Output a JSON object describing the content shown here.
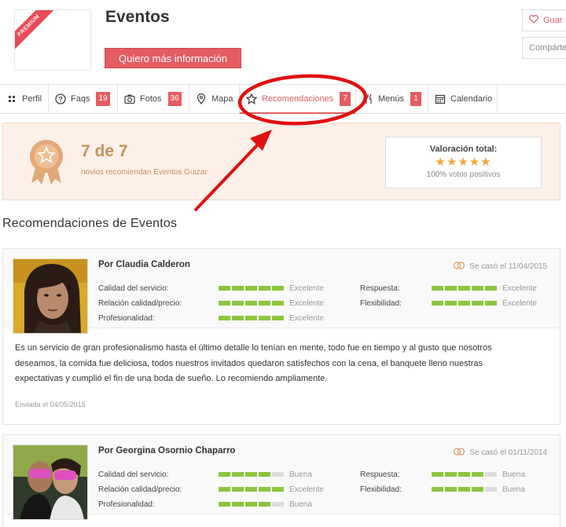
{
  "header": {
    "title": "Eventos",
    "premium_label": "PREMIUM",
    "info_button": "Quiero más información",
    "save_label": "Guar",
    "share_label": "Compártel"
  },
  "tabs": [
    {
      "label": "Perfil",
      "icon": "grid-icon"
    },
    {
      "label": "Faqs",
      "icon": "question-icon",
      "badge": "19"
    },
    {
      "label": "Fotos",
      "icon": "camera-icon",
      "badge": "36"
    },
    {
      "label": "Mapa",
      "icon": "map-pin-icon"
    },
    {
      "label": "Recomendaciones",
      "icon": "star-icon",
      "badge": "7",
      "active": true
    },
    {
      "label": "Menús",
      "icon": "cutlery-icon",
      "badge": "1"
    },
    {
      "label": "Calendario",
      "icon": "calendar-icon"
    }
  ],
  "summary": {
    "count": "7 de 7",
    "subtitle": "novios recomiendan Eventos Guizar",
    "rating_title": "Valoración total:",
    "rating_stars": 5,
    "rating_sub": "100% votos positivos"
  },
  "section_title": "Recomendaciones de Eventos",
  "colors": {
    "accent": "#e45d63",
    "gold": "#c8915f",
    "bar_on": "#8cc63f",
    "bar_off": "#dddddd",
    "star": "#f0a53b"
  },
  "reviews": [
    {
      "author": "Por Claudia Calderon",
      "wedding_date": "Se casó el 11/04/2015",
      "criteria_left": [
        {
          "label": "Calidad del servicio:",
          "score": 5,
          "value": "Excelente"
        },
        {
          "label": "Relación calidad/precio:",
          "score": 5,
          "value": "Excelente"
        },
        {
          "label": "Profesionalidad:",
          "score": 5,
          "value": "Excelente"
        }
      ],
      "criteria_right": [
        {
          "label": "Respuesta:",
          "score": 5,
          "value": "Excelente"
        },
        {
          "label": "Flexibilidad:",
          "score": 5,
          "value": "Excelente"
        }
      ],
      "lines": [
        "Es un servicio de gran profesionalismo hasta el último detalle lo tenían en mente, todo fue en tiempo y al gusto que nosotros",
        "deseamos, la comida fue deliciosa, todos nuestros invitados quedaron satisfechos con la cena, el banquete lleno nuestras",
        "expectativas y cumplió el fin de una boda de sueño. Lo recomiendo ampliamente."
      ],
      "sent": "Enviada el 04/05/2015"
    },
    {
      "author": "Por Georgina Osornio Chaparro",
      "wedding_date": "Se casó el 01/11/2014",
      "criteria_left": [
        {
          "label": "Calidad del servicio:",
          "score": 4,
          "value": "Buena"
        },
        {
          "label": "Relación calidad/precio:",
          "score": 5,
          "value": "Excelente"
        },
        {
          "label": "Profesionalidad:",
          "score": 4,
          "value": "Buena"
        }
      ],
      "criteria_right": [
        {
          "label": "Respuesta:",
          "score": 4,
          "value": "Buena"
        },
        {
          "label": "Flexibilidad:",
          "score": 4,
          "value": "Buena"
        }
      ]
    }
  ]
}
